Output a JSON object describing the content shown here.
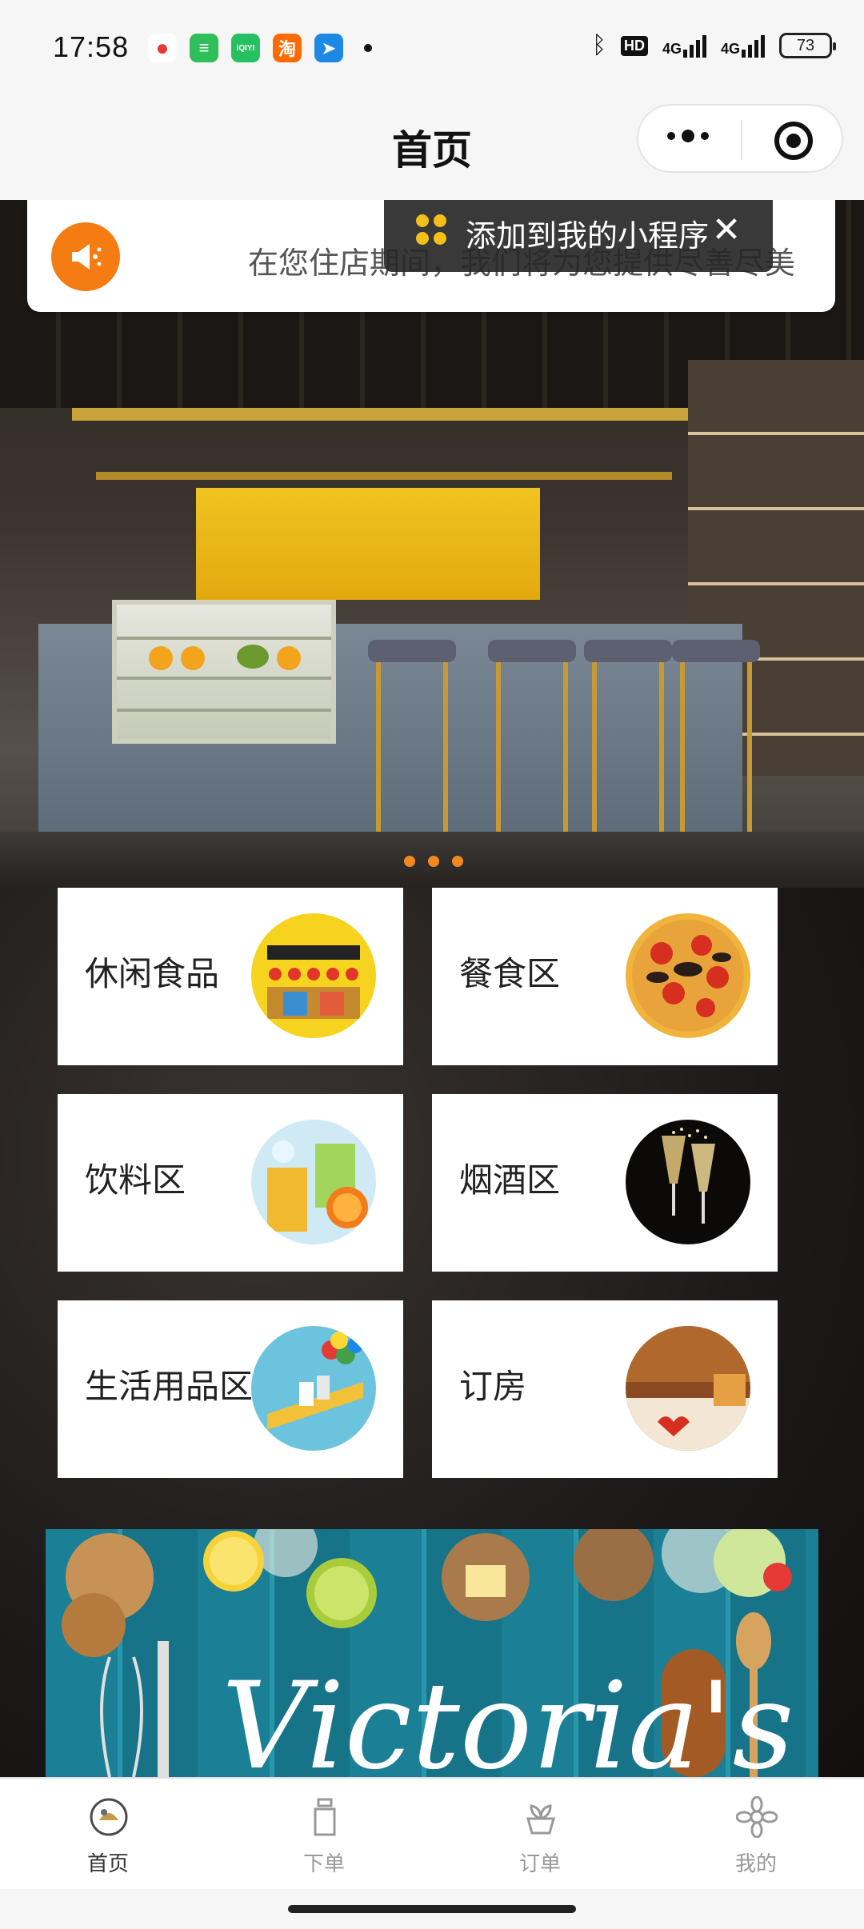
{
  "status_bar": {
    "time": "17:58",
    "app_icons": [
      {
        "name": "weibo-icon",
        "color": "#e53935",
        "glyph": "●"
      },
      {
        "name": "message-icon",
        "color": "#2fbf5a",
        "glyph": "≡"
      },
      {
        "name": "iqiyi-icon",
        "color": "#25c060",
        "glyph": "iQIYI"
      },
      {
        "name": "taobao-icon",
        "color": "#ff6a00",
        "glyph": "淘"
      },
      {
        "name": "navigation-icon",
        "color": "#1e88e5",
        "glyph": "➤"
      }
    ],
    "hd_label": "HD",
    "net1_label": "4G",
    "net2_label": "4G",
    "battery": "73"
  },
  "nav": {
    "title": "首页"
  },
  "notice": {
    "text": "在您住店期间，我们将为您提供尽善尽美"
  },
  "tooltip": {
    "text": "添加到我的小程序",
    "close": "✕"
  },
  "categories": [
    {
      "label": "休闲食品",
      "icon": "snacks-image"
    },
    {
      "label": "餐食区",
      "icon": "pizza-image"
    },
    {
      "label": "饮料区",
      "icon": "juice-image"
    },
    {
      "label": "烟酒区",
      "icon": "champagne-image"
    },
    {
      "label": "生活用品区",
      "icon": "daily-goods-image"
    },
    {
      "label": "订房",
      "icon": "room-image"
    }
  ],
  "banner": {
    "script": "Victoria's"
  },
  "tabbar": {
    "tabs": [
      {
        "label": "首页",
        "icon": "home-icon",
        "active": true
      },
      {
        "label": "下单",
        "icon": "bottle-icon",
        "active": false
      },
      {
        "label": "订单",
        "icon": "plant-icon",
        "active": false
      },
      {
        "label": "我的",
        "icon": "flower-icon",
        "active": false
      }
    ]
  },
  "colors": {
    "accent_orange": "#f57c13",
    "tooltip_bg": "#282828",
    "tooltip_icon": "#f2c017",
    "dark_bg": "#1d1a19"
  }
}
